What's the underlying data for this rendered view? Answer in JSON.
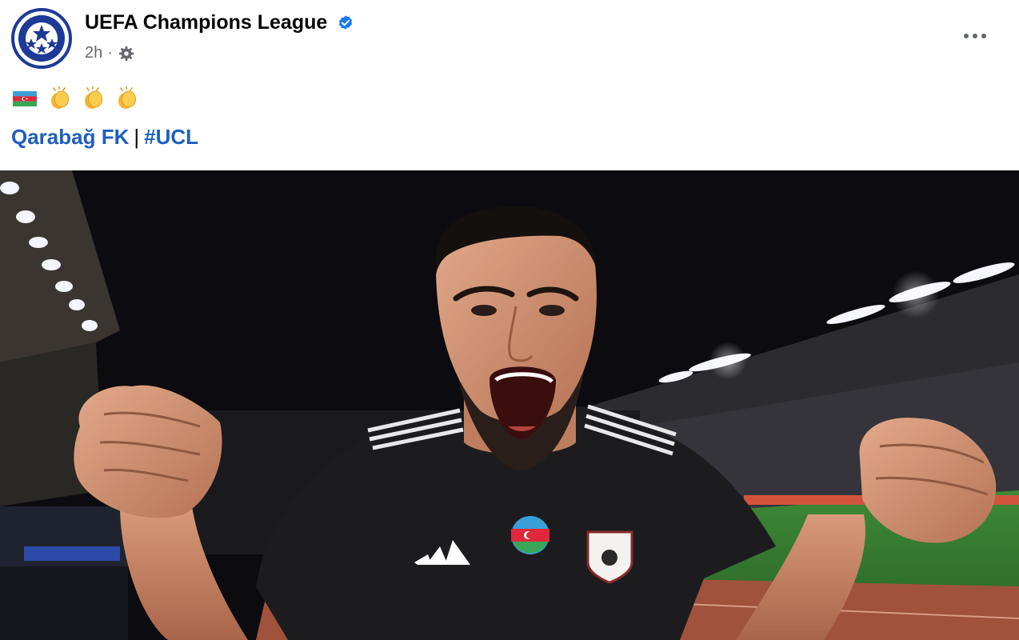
{
  "post": {
    "page_name": "UEFA Champions League",
    "verified": true,
    "time_ago": "2h",
    "separator": "·",
    "audience_icon": "gear-icon",
    "more_icon": "more-options-icon",
    "emojis": [
      "azerbaijan-flag",
      "clapping-hands",
      "clapping-hands",
      "clapping-hands"
    ],
    "tags": [
      {
        "label": "Qarabağ FK"
      },
      {
        "label": "#UCL"
      }
    ],
    "tag_separator": "|"
  },
  "photo": {
    "description_icon": "celebrating-player-photo"
  },
  "colors": {
    "link": "#1d5fbf",
    "verified": "#1877f2",
    "brand": "#1d3a96",
    "muted": "#65676b"
  }
}
